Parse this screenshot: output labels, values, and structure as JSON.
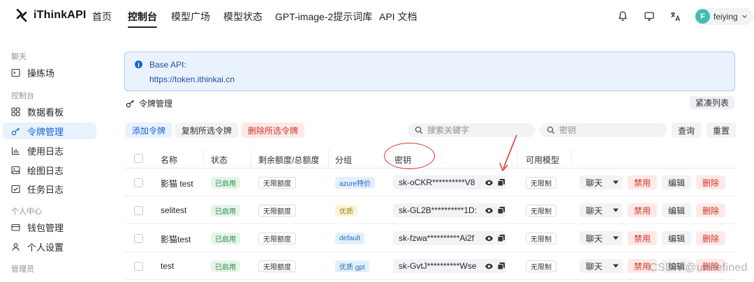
{
  "brand": {
    "name": "iThinkAPI"
  },
  "nav": {
    "items": [
      "首页",
      "控制台",
      "模型广场",
      "模型状态",
      "GPT-image-2提示词库",
      "API 文档"
    ],
    "active": "控制台"
  },
  "top_icons": [
    "bell-icon",
    "monitor-icon",
    "translate-icon"
  ],
  "user": {
    "initial": "F",
    "name": "feiying",
    "avatar_color": "#3fbfa9"
  },
  "sidebar": {
    "groups": [
      {
        "label": "聊天",
        "items": [
          {
            "label": "操练场",
            "icon": "terminal-icon"
          }
        ]
      },
      {
        "label": "控制台",
        "items": [
          {
            "label": "数据看板",
            "icon": "dashboard-icon"
          },
          {
            "label": "令牌管理",
            "icon": "key-icon",
            "active": true
          },
          {
            "label": "使用日志",
            "icon": "bar-chart-icon"
          },
          {
            "label": "绘图日志",
            "icon": "image-icon"
          },
          {
            "label": "任务日志",
            "icon": "checklist-icon"
          }
        ]
      },
      {
        "label": "个人中心",
        "items": [
          {
            "label": "钱包管理",
            "icon": "wallet-icon"
          },
          {
            "label": "个人设置",
            "icon": "user-icon"
          }
        ]
      },
      {
        "label": "管理员",
        "items": []
      }
    ]
  },
  "banner": {
    "title": "Base API:",
    "url": "https://token.ithinkai.cn"
  },
  "section": {
    "title": "令牌管理",
    "compact_label": "紧凑列表"
  },
  "toolbar": {
    "add": "添加令牌",
    "copy_selected": "复制所选令牌",
    "delete_selected": "删除所选令牌",
    "search_keyword_placeholder": "搜索关键字",
    "search_key_placeholder": "密钥",
    "query": "查询",
    "reset": "重置"
  },
  "table": {
    "columns": [
      "名称",
      "状态",
      "剩余额度/总额度",
      "分组",
      "密钥",
      "可用模型"
    ],
    "rows": [
      {
        "name": "影猫 test",
        "status": "已启用",
        "quota": "无限额度",
        "group": "azure特价",
        "group_style": "blue",
        "key": "sk-oCKR**********V8",
        "models": "无限制"
      },
      {
        "name": "selitest",
        "status": "已启用",
        "quota": "无限额度",
        "group": "优质",
        "group_style": "yellow",
        "key": "sk-GL2B**********1D:",
        "models": "无限制"
      },
      {
        "name": "影猫test",
        "status": "已启用",
        "quota": "无限额度",
        "group": "default",
        "group_style": "skyblue",
        "key": "sk-fzwa**********Ai2f",
        "models": "无限制"
      },
      {
        "name": "test",
        "status": "已启用",
        "quota": "无限额度",
        "group": "优质 gpt",
        "group_style": "skyblue",
        "key": "sk-GvtJ**********Wse",
        "models": "无限制"
      }
    ],
    "row_actions": {
      "chat": "聊天",
      "disable": "禁用",
      "edit": "编辑",
      "delete": "删除"
    }
  },
  "annotations": {
    "highlight_color": "#e2342b"
  },
  "watermark": "CSDN @undefined"
}
